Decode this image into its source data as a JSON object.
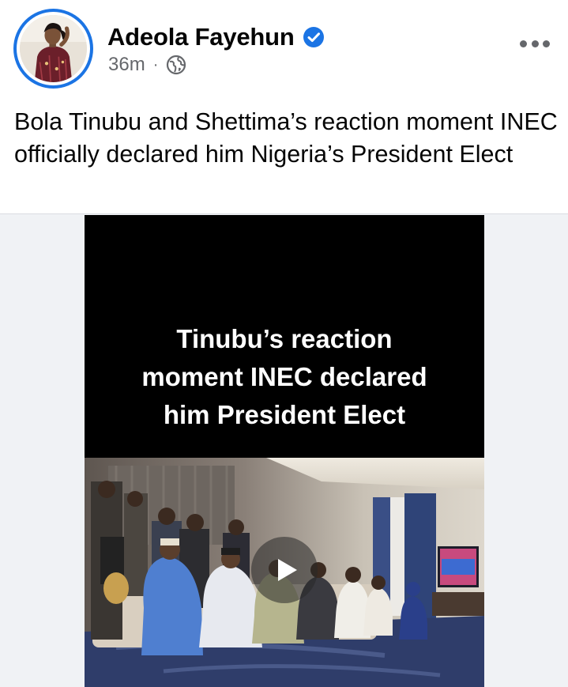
{
  "post": {
    "author": "Adeola Fayehun",
    "time": "36m",
    "separator": "·",
    "audience_icon": "globe-icon",
    "verified_icon": "verified-badge-icon",
    "more_icon": "more-options-icon",
    "text": "Bola Tinubu and Shettima’s reaction moment INEC officially declared him Nigeria’s President Elect"
  },
  "video": {
    "caption_lines": [
      "Tinubu’s reaction",
      "moment INEC declared",
      "him President Elect"
    ],
    "play_icon": "play-icon"
  },
  "colors": {
    "verified_blue": "#1b74e4",
    "secondary_text": "#65676b",
    "media_background": "#f0f2f5"
  }
}
